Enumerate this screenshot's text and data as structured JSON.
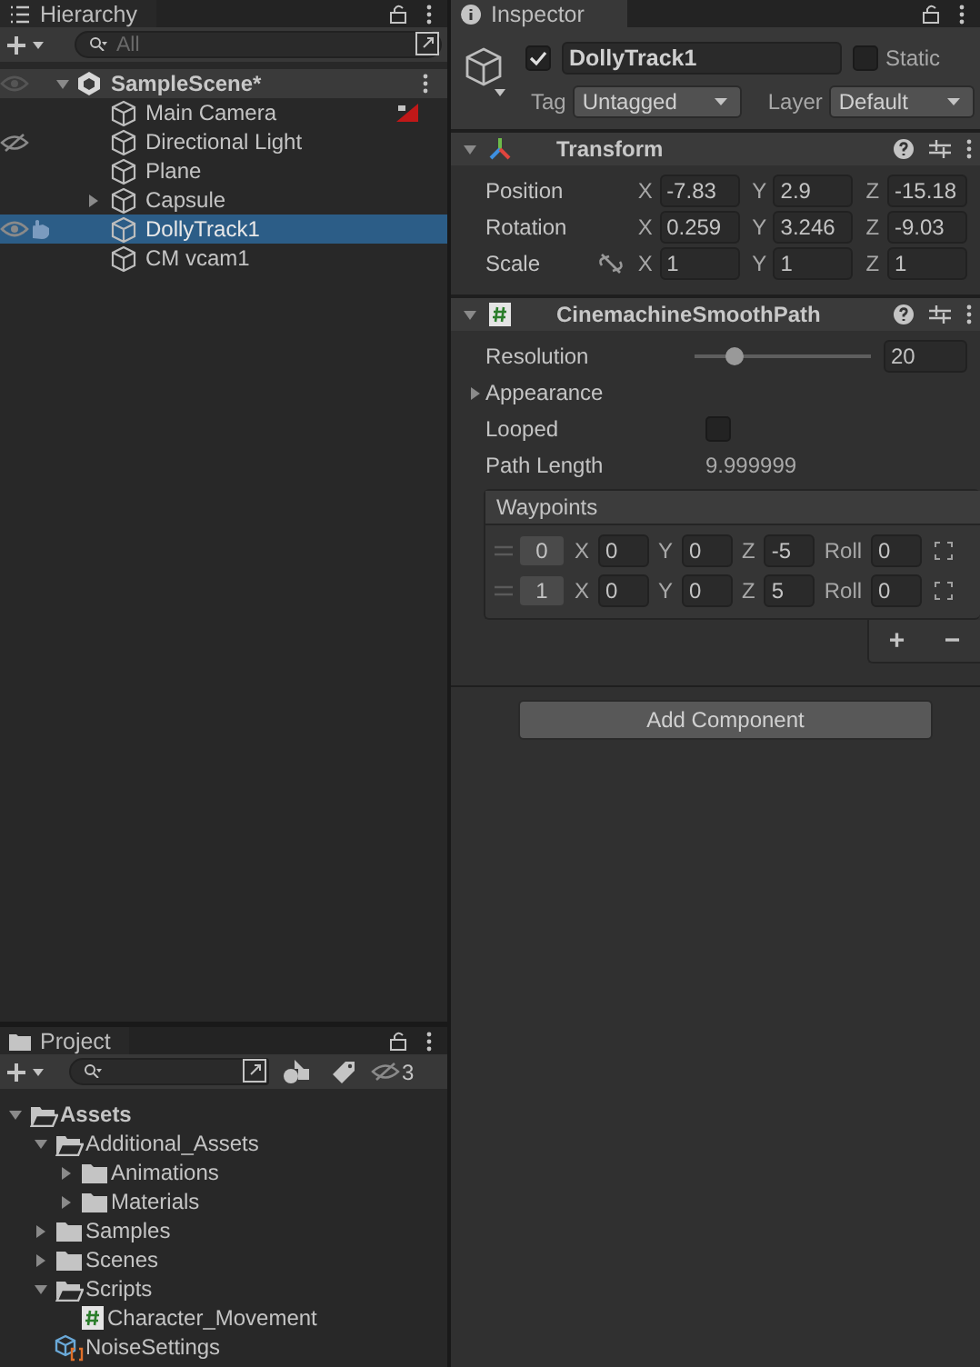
{
  "hierarchy": {
    "title": "Hierarchy",
    "search_placeholder": "All",
    "scene": {
      "name": "SampleScene*",
      "expanded": true
    },
    "items": [
      {
        "name": "Main Camera",
        "selected": false,
        "hidden": false,
        "collapsed": false,
        "gizmo": true
      },
      {
        "name": "Directional Light",
        "selected": false,
        "hidden": true,
        "collapsed": false,
        "gizmo": false
      },
      {
        "name": "Plane",
        "selected": false,
        "hidden": false,
        "collapsed": false,
        "gizmo": false
      },
      {
        "name": "Capsule",
        "selected": false,
        "hidden": false,
        "collapsed": true,
        "gizmo": false
      },
      {
        "name": "DollyTrack1",
        "selected": true,
        "hidden": false,
        "collapsed": false,
        "gizmo": false
      },
      {
        "name": "CM vcam1",
        "selected": false,
        "hidden": false,
        "collapsed": false,
        "gizmo": false
      }
    ]
  },
  "inspector": {
    "title": "Inspector",
    "object": {
      "active": true,
      "name": "DollyTrack1",
      "static": false,
      "static_label": "Static",
      "tag_label": "Tag",
      "tag": "Untagged",
      "layer_label": "Layer",
      "layer": "Default"
    },
    "components": [
      {
        "kind": "transform",
        "title": "Transform",
        "expanded": true,
        "rows": [
          {
            "label": "Position",
            "fields": [
              {
                "axis": "X",
                "value": "-7.83"
              },
              {
                "axis": "Y",
                "value": "2.9"
              },
              {
                "axis": "Z",
                "value": "-15.18"
              }
            ]
          },
          {
            "label": "Rotation",
            "fields": [
              {
                "axis": "X",
                "value": "0.259"
              },
              {
                "axis": "Y",
                "value": "3.246"
              },
              {
                "axis": "Z",
                "value": "-9.03"
              }
            ]
          },
          {
            "label": "Scale",
            "constrained": false,
            "fields": [
              {
                "axis": "X",
                "value": "1"
              },
              {
                "axis": "Y",
                "value": "1"
              },
              {
                "axis": "Z",
                "value": "1"
              }
            ]
          }
        ]
      },
      {
        "kind": "script",
        "title": "CinemachineSmoothPath",
        "expanded": true,
        "properties": [
          {
            "kind": "slider",
            "label": "Resolution",
            "level": 0.2,
            "value": "20"
          },
          {
            "kind": "foldout",
            "label": "Appearance",
            "expanded": false
          },
          {
            "kind": "checkbox",
            "label": "Looped",
            "checked": false
          },
          {
            "kind": "readout",
            "label": "Path Length",
            "value": "9.999999"
          },
          {
            "kind": "list",
            "label": "Waypoints",
            "items": [
              {
                "index": "0",
                "fields": [
                  {
                    "axis": "X",
                    "value": "0"
                  },
                  {
                    "axis": "Y",
                    "value": "0"
                  },
                  {
                    "axis": "Z",
                    "value": "-5"
                  },
                  {
                    "axis": "Roll",
                    "value": "0"
                  }
                ]
              },
              {
                "index": "1",
                "fields": [
                  {
                    "axis": "X",
                    "value": "0"
                  },
                  {
                    "axis": "Y",
                    "value": "0"
                  },
                  {
                    "axis": "Z",
                    "value": "5"
                  },
                  {
                    "axis": "Roll",
                    "value": "0"
                  }
                ]
              }
            ],
            "buttons": [
              "+",
              "−"
            ]
          }
        ]
      }
    ],
    "add_component": "Add Component"
  },
  "project": {
    "title": "Project",
    "hidden_count": "3",
    "tree": [
      {
        "name": "Assets",
        "kind": "folder",
        "expanded": true,
        "children": [
          {
            "name": "Additional_Assets",
            "kind": "folder",
            "expanded": true,
            "children": [
              {
                "name": "Animations",
                "kind": "folder",
                "expanded": false
              },
              {
                "name": "Materials",
                "kind": "folder",
                "expanded": false
              }
            ]
          },
          {
            "name": "Samples",
            "kind": "folder",
            "expanded": false
          },
          {
            "name": "Scenes",
            "kind": "folder",
            "expanded": false
          },
          {
            "name": "Scripts",
            "kind": "folder",
            "expanded": true,
            "children": [
              {
                "name": "Character_Movement",
                "kind": "script"
              }
            ]
          },
          {
            "name": "NoiseSettings",
            "kind": "asset"
          }
        ]
      }
    ]
  }
}
